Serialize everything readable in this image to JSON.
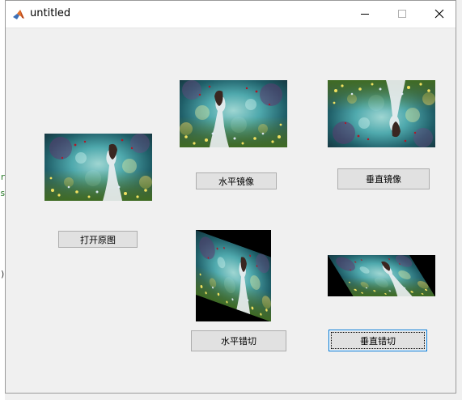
{
  "window": {
    "title": "untitled"
  },
  "buttons": {
    "open_original": "打开原图",
    "horizontal_mirror": "水平镜像",
    "vertical_mirror": "垂直镜像",
    "horizontal_shear": "水平错切",
    "vertical_shear": "垂直错切"
  },
  "background_glyphs": [
    "r",
    "s",
    ")"
  ],
  "colors": {
    "focus_border": "#0078d7",
    "button_bg": "#e1e1e1",
    "window_bg": "#f0f0f0"
  }
}
